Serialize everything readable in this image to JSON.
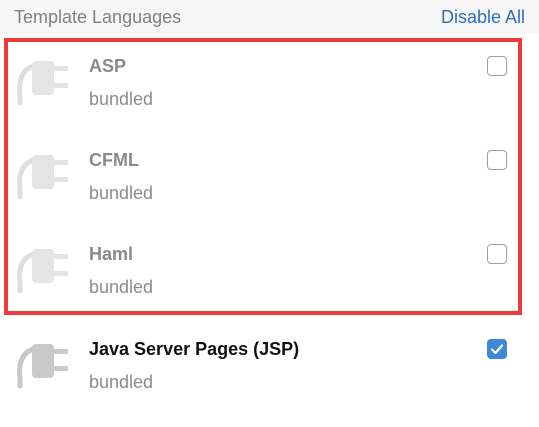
{
  "header": {
    "title": "Template Languages",
    "action": "Disable All"
  },
  "plugins": [
    {
      "name": "ASP",
      "source": "bundled",
      "enabled": false,
      "icon": "plugin-plug-icon"
    },
    {
      "name": "CFML",
      "source": "bundled",
      "enabled": false,
      "icon": "plugin-plug-icon"
    },
    {
      "name": "Haml",
      "source": "bundled",
      "enabled": false,
      "icon": "plugin-plug-icon"
    },
    {
      "name": "Java Server Pages (JSP)",
      "source": "bundled",
      "enabled": true,
      "icon": "plugin-plug-icon"
    }
  ],
  "colors": {
    "highlight_border": "#ee3a3a",
    "link": "#2f6fb3",
    "checkbox_checked": "#3e88d6"
  }
}
